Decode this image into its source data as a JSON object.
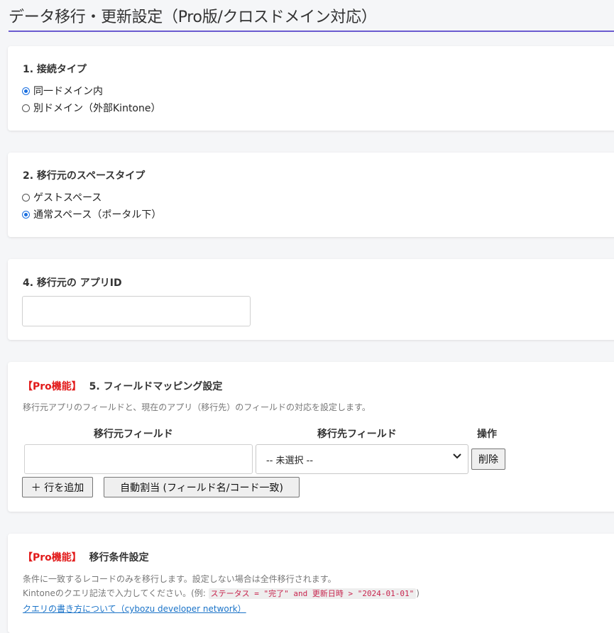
{
  "page": {
    "title": "データ移行・更新設定（Pro版/クロスドメイン対応）",
    "accent_color": "#6b5bd0"
  },
  "connection": {
    "title": "1. 接続タイプ",
    "options": [
      {
        "label": "同一ドメイン内",
        "checked": true
      },
      {
        "label": "別ドメイン（外部Kintone）",
        "checked": false
      }
    ]
  },
  "space_type": {
    "title": "2. 移行元のスペースタイプ",
    "options": [
      {
        "label": "ゲストスペース",
        "checked": false
      },
      {
        "label": "通常スペース（ポータル下）",
        "checked": true
      }
    ]
  },
  "app_id": {
    "title": "4. 移行元の アプリID",
    "value": ""
  },
  "mapping": {
    "pro_tag": "【Pro機能】",
    "title": "5. フィールドマッピング設定",
    "description": "移行元アプリのフィールドと、現在のアプリ（移行先）のフィールドの対応を設定します。",
    "headers": {
      "source": "移行元フィールド",
      "target": "移行先フィールド",
      "action": "操作"
    },
    "rows": [
      {
        "source": "",
        "target": "-- 未選択 --",
        "delete_label": "削除"
      }
    ],
    "add_row_label": "＋ 行を追加",
    "auto_assign_label": "自動割当 (フィールド名/コード一致)"
  },
  "conditions": {
    "pro_tag": "【Pro機能】",
    "title": "移行条件設定",
    "desc1": "条件に一致するレコードのみを移行します。設定しない場合は全件移行されます。",
    "desc2_prefix": "Kintoneのクエリ記法で入力してください。(例: ",
    "desc2_code": "ステータス = \"完了\" and 更新日時 > \"2024-01-01\"",
    "desc2_suffix": ")",
    "link_text": "クエリの書き方について（cybozu developer network）"
  },
  "colors": {
    "pro_tag": "#e21b1b",
    "radio_checked": "#1a6fe0",
    "link": "#1a73c8"
  }
}
